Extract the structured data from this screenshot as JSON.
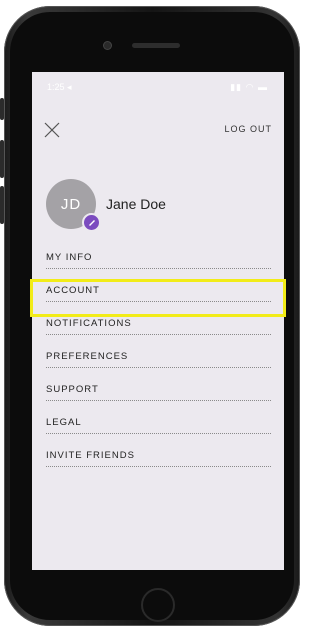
{
  "status_bar": {
    "time": "1:25 ◂",
    "icons_text": "▮▮ ◠ ▬"
  },
  "header": {
    "close_icon": "close-icon",
    "logout_label": "LOG OUT"
  },
  "profile": {
    "initials": "JD",
    "name": "Jane Doe",
    "edit_icon": "pencil-icon",
    "badge_color": "#7b4bbf"
  },
  "menu": {
    "items": [
      {
        "label": "MY INFO"
      },
      {
        "label": "ACCOUNT",
        "highlighted": true
      },
      {
        "label": "NOTIFICATIONS"
      },
      {
        "label": "PREFERENCES"
      },
      {
        "label": "SUPPORT"
      },
      {
        "label": "LEGAL"
      },
      {
        "label": "INVITE FRIENDS"
      }
    ]
  },
  "colors": {
    "screen_bg": "#ece9ef",
    "highlight": "#f2ec18"
  }
}
